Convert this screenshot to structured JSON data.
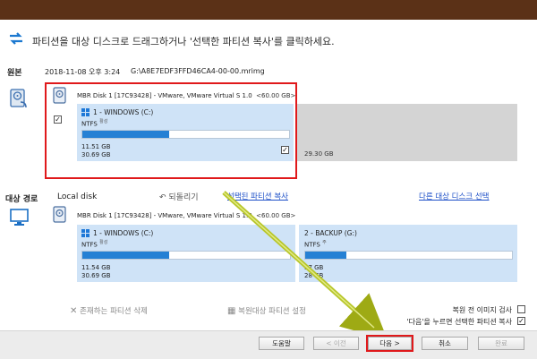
{
  "window": {
    "titlebar_color": "#5b3117"
  },
  "instruction": "파티션을 대상 디스크로 드래그하거나 '선택한 파티션 복사'를 클릭하세요.",
  "source": {
    "label": "원본",
    "datetime": "2018-11-08 오후 3:24",
    "image_path": "G:\\A8E7EDF3FFD46CA4-00-00.mrimg",
    "disk": {
      "header": "MBR Disk 1 [17C93428] - VMware,  VMware Virtual S 1.0",
      "capacity": "<60.00 GB>"
    },
    "partition": {
      "name": "1 - WINDOWS (C:)",
      "fs": "NTFS",
      "fs_tag": "활성",
      "used": "11.51 GB",
      "total": "30.69 GB",
      "fill_fraction": 0.42,
      "checked": true,
      "checkmark": "✓"
    },
    "unallocated": {
      "size": "29.30 GB"
    },
    "row_checkbox_checked": true
  },
  "target": {
    "label": "대상 경로",
    "location": "Local disk",
    "undo_label": "되돌리기",
    "copy_link": "선택된 파티션 복사",
    "other_disk_link": "다른 대상 디스크 선택",
    "disk": {
      "header": "MBR Disk 1 [17C93428] - VMware,  VMware Virtual S 1.0",
      "capacity": "<60.00 GB>"
    },
    "partitions": [
      {
        "name": "1 - WINDOWS (C:)",
        "fs": "NTFS",
        "fs_tag": "활성",
        "used": "11.54 GB",
        "total": "30.69 GB",
        "fill_fraction": 0.42
      },
      {
        "name": "2 - BACKUP (G:)",
        "fs": "NTFS",
        "fs_tag": "주",
        "used": "57 GB",
        "total": "28 GB",
        "fill_fraction": 0.2
      }
    ],
    "delete_action": "존재하는 파티션 삭제",
    "restore_settings_action": "복원대상 파티션 설정"
  },
  "options": {
    "verify_label": "복원 전 이미지 검사",
    "verify_checked": false,
    "copy_on_next_label": "'다음'을 누르면 선택한 파티션 복사",
    "copy_on_next_checked": true,
    "checkmark": "✓"
  },
  "buttons": {
    "help": "도움말",
    "back": "< 이전",
    "next": "다음 >",
    "cancel": "취소",
    "finish": "완료"
  },
  "colors": {
    "highlight": "#e0191b",
    "partition_bg": "#cfe3f7",
    "bar_fill": "#2580d4",
    "arrow": "#b0bf1a"
  }
}
